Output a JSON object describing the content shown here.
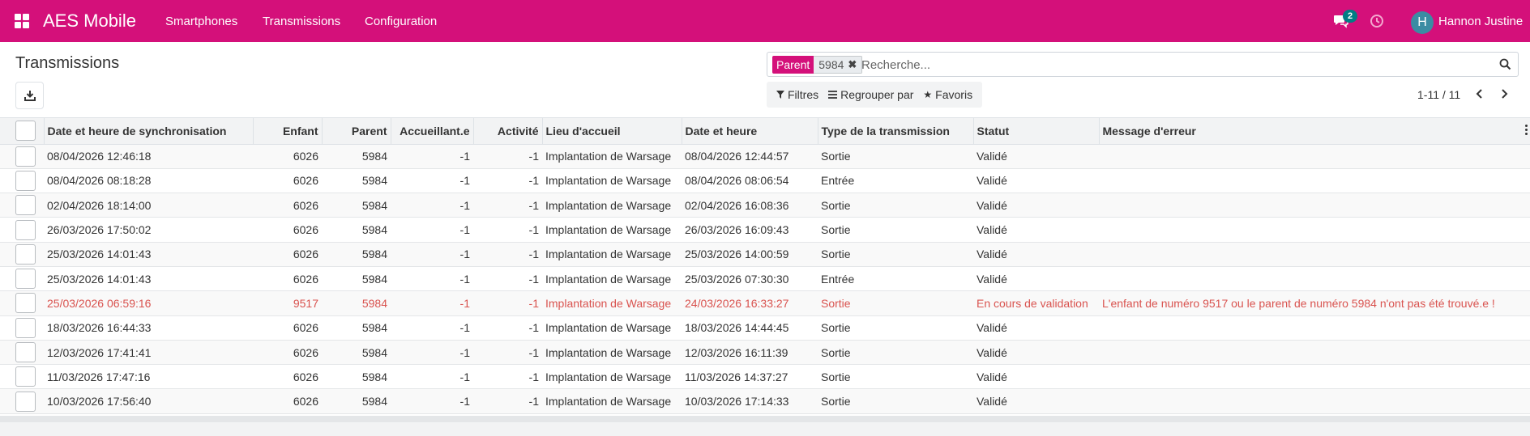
{
  "navbar": {
    "brand": "AES Mobile",
    "menu": [
      "Smartphones",
      "Transmissions",
      "Configuration"
    ],
    "chat_badge": "2",
    "avatar_letter": "H",
    "user_name": "Hannon Justine",
    "bg_color": "#d4107a"
  },
  "control": {
    "title": "Transmissions",
    "search": {
      "facet_label": "Parent",
      "facet_value": "5984",
      "placeholder": "Recherche..."
    },
    "filters": {
      "filters_label": "Filtres",
      "group_label": "Regrouper par",
      "favorites_label": "Favoris"
    },
    "pager": "1-11 / 11"
  },
  "table": {
    "columns": [
      "Date et heure de synchronisation",
      "Enfant",
      "Parent",
      "Accueillant.e",
      "Activité",
      "Lieu d'accueil",
      "Date et heure",
      "Type de la transmission",
      "Statut",
      "Message d'erreur"
    ],
    "rows": [
      {
        "sync": "08/04/2026 12:46:18",
        "enfant": "6026",
        "parent": "5984",
        "accueillant": "-1",
        "activite": "-1",
        "lieu": "Implantation de Warsage",
        "date": "08/04/2026 12:44:57",
        "type": "Sortie",
        "statut": "Validé",
        "erreur": ""
      },
      {
        "sync": "08/04/2026 08:18:28",
        "enfant": "6026",
        "parent": "5984",
        "accueillant": "-1",
        "activite": "-1",
        "lieu": "Implantation de Warsage",
        "date": "08/04/2026 08:06:54",
        "type": "Entrée",
        "statut": "Validé",
        "erreur": ""
      },
      {
        "sync": "02/04/2026 18:14:00",
        "enfant": "6026",
        "parent": "5984",
        "accueillant": "-1",
        "activite": "-1",
        "lieu": "Implantation de Warsage",
        "date": "02/04/2026 16:08:36",
        "type": "Sortie",
        "statut": "Validé",
        "erreur": ""
      },
      {
        "sync": "26/03/2026 17:50:02",
        "enfant": "6026",
        "parent": "5984",
        "accueillant": "-1",
        "activite": "-1",
        "lieu": "Implantation de Warsage",
        "date": "26/03/2026 16:09:43",
        "type": "Sortie",
        "statut": "Validé",
        "erreur": ""
      },
      {
        "sync": "25/03/2026 14:01:43",
        "enfant": "6026",
        "parent": "5984",
        "accueillant": "-1",
        "activite": "-1",
        "lieu": "Implantation de Warsage",
        "date": "25/03/2026 14:00:59",
        "type": "Sortie",
        "statut": "Validé",
        "erreur": ""
      },
      {
        "sync": "25/03/2026 14:01:43",
        "enfant": "6026",
        "parent": "5984",
        "accueillant": "-1",
        "activite": "-1",
        "lieu": "Implantation de Warsage",
        "date": "25/03/2026 07:30:30",
        "type": "Entrée",
        "statut": "Validé",
        "erreur": ""
      },
      {
        "sync": "25/03/2026 06:59:16",
        "enfant": "9517",
        "parent": "5984",
        "accueillant": "-1",
        "activite": "-1",
        "lieu": "Implantation de Warsage",
        "date": "24/03/2026 16:33:27",
        "type": "Sortie",
        "statut": "En cours de validation",
        "erreur": "L'enfant de numéro 9517 ou le parent de numéro 5984 n'ont pas été trouvé.e !",
        "error": true
      },
      {
        "sync": "18/03/2026 16:44:33",
        "enfant": "6026",
        "parent": "5984",
        "accueillant": "-1",
        "activite": "-1",
        "lieu": "Implantation de Warsage",
        "date": "18/03/2026 14:44:45",
        "type": "Sortie",
        "statut": "Validé",
        "erreur": ""
      },
      {
        "sync": "12/03/2026 17:41:41",
        "enfant": "6026",
        "parent": "5984",
        "accueillant": "-1",
        "activite": "-1",
        "lieu": "Implantation de Warsage",
        "date": "12/03/2026 16:11:39",
        "type": "Sortie",
        "statut": "Validé",
        "erreur": ""
      },
      {
        "sync": "11/03/2026 17:47:16",
        "enfant": "6026",
        "parent": "5984",
        "accueillant": "-1",
        "activite": "-1",
        "lieu": "Implantation de Warsage",
        "date": "11/03/2026 14:37:27",
        "type": "Sortie",
        "statut": "Validé",
        "erreur": ""
      },
      {
        "sync": "10/03/2026 17:56:40",
        "enfant": "6026",
        "parent": "5984",
        "accueillant": "-1",
        "activite": "-1",
        "lieu": "Implantation de Warsage",
        "date": "10/03/2026 17:14:33",
        "type": "Sortie",
        "statut": "Validé",
        "erreur": ""
      }
    ]
  }
}
